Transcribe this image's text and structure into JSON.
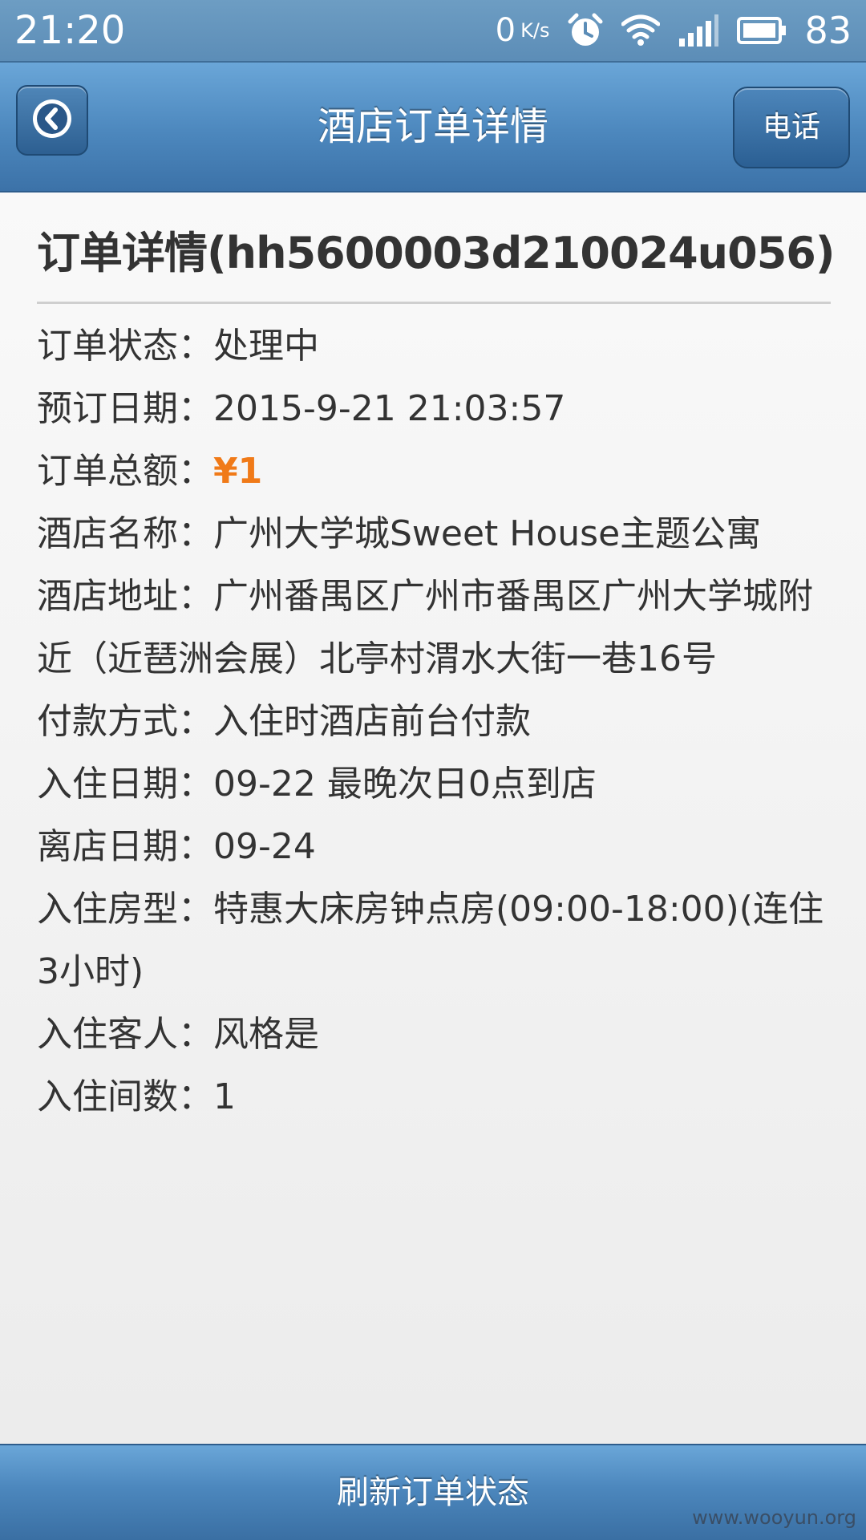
{
  "status_bar": {
    "time": "21:20",
    "net_speed": "0",
    "net_unit": "K/s",
    "battery": "83",
    "icons": [
      "alarm-icon",
      "wifi-icon",
      "signal-icon",
      "battery-icon"
    ]
  },
  "header": {
    "title": "酒店订单详情",
    "back_icon": "chevron-left-icon",
    "phone_label": "电话"
  },
  "order": {
    "heading": "订单详情(hh5600003d210024u056)",
    "fields": [
      {
        "label": "订单状态：",
        "value": "处理中"
      },
      {
        "label": "预订日期：",
        "value": "2015-9-21 21:03:57"
      },
      {
        "label": "订单总额：",
        "value": "¥1"
      },
      {
        "label": "酒店名称：",
        "value": "广州大学城Sweet House主题公寓"
      },
      {
        "label": "酒店地址：",
        "value": "广州番禺区广州市番禺区广州大学城附近（近琶洲会展）北亭村渭水大街一巷16号"
      },
      {
        "label": "付款方式：",
        "value": "入住时酒店前台付款"
      },
      {
        "label": "入住日期：",
        "value": "09-22 最晚次日0点到店"
      },
      {
        "label": "离店日期：",
        "value": "09-24"
      },
      {
        "label": "入住房型：",
        "value": "特惠大床房钟点房(09:00-18:00)(连住3小时)"
      },
      {
        "label": "入住客人：",
        "value": "风格是"
      },
      {
        "label": "入住间数：",
        "value": "1"
      }
    ]
  },
  "footer": {
    "refresh_label": "刷新订单状态",
    "watermark": "www.wooyun.org"
  },
  "colors": {
    "header_blue": "#4c87bd",
    "price_orange": "#f07a18",
    "text": "#333333"
  }
}
